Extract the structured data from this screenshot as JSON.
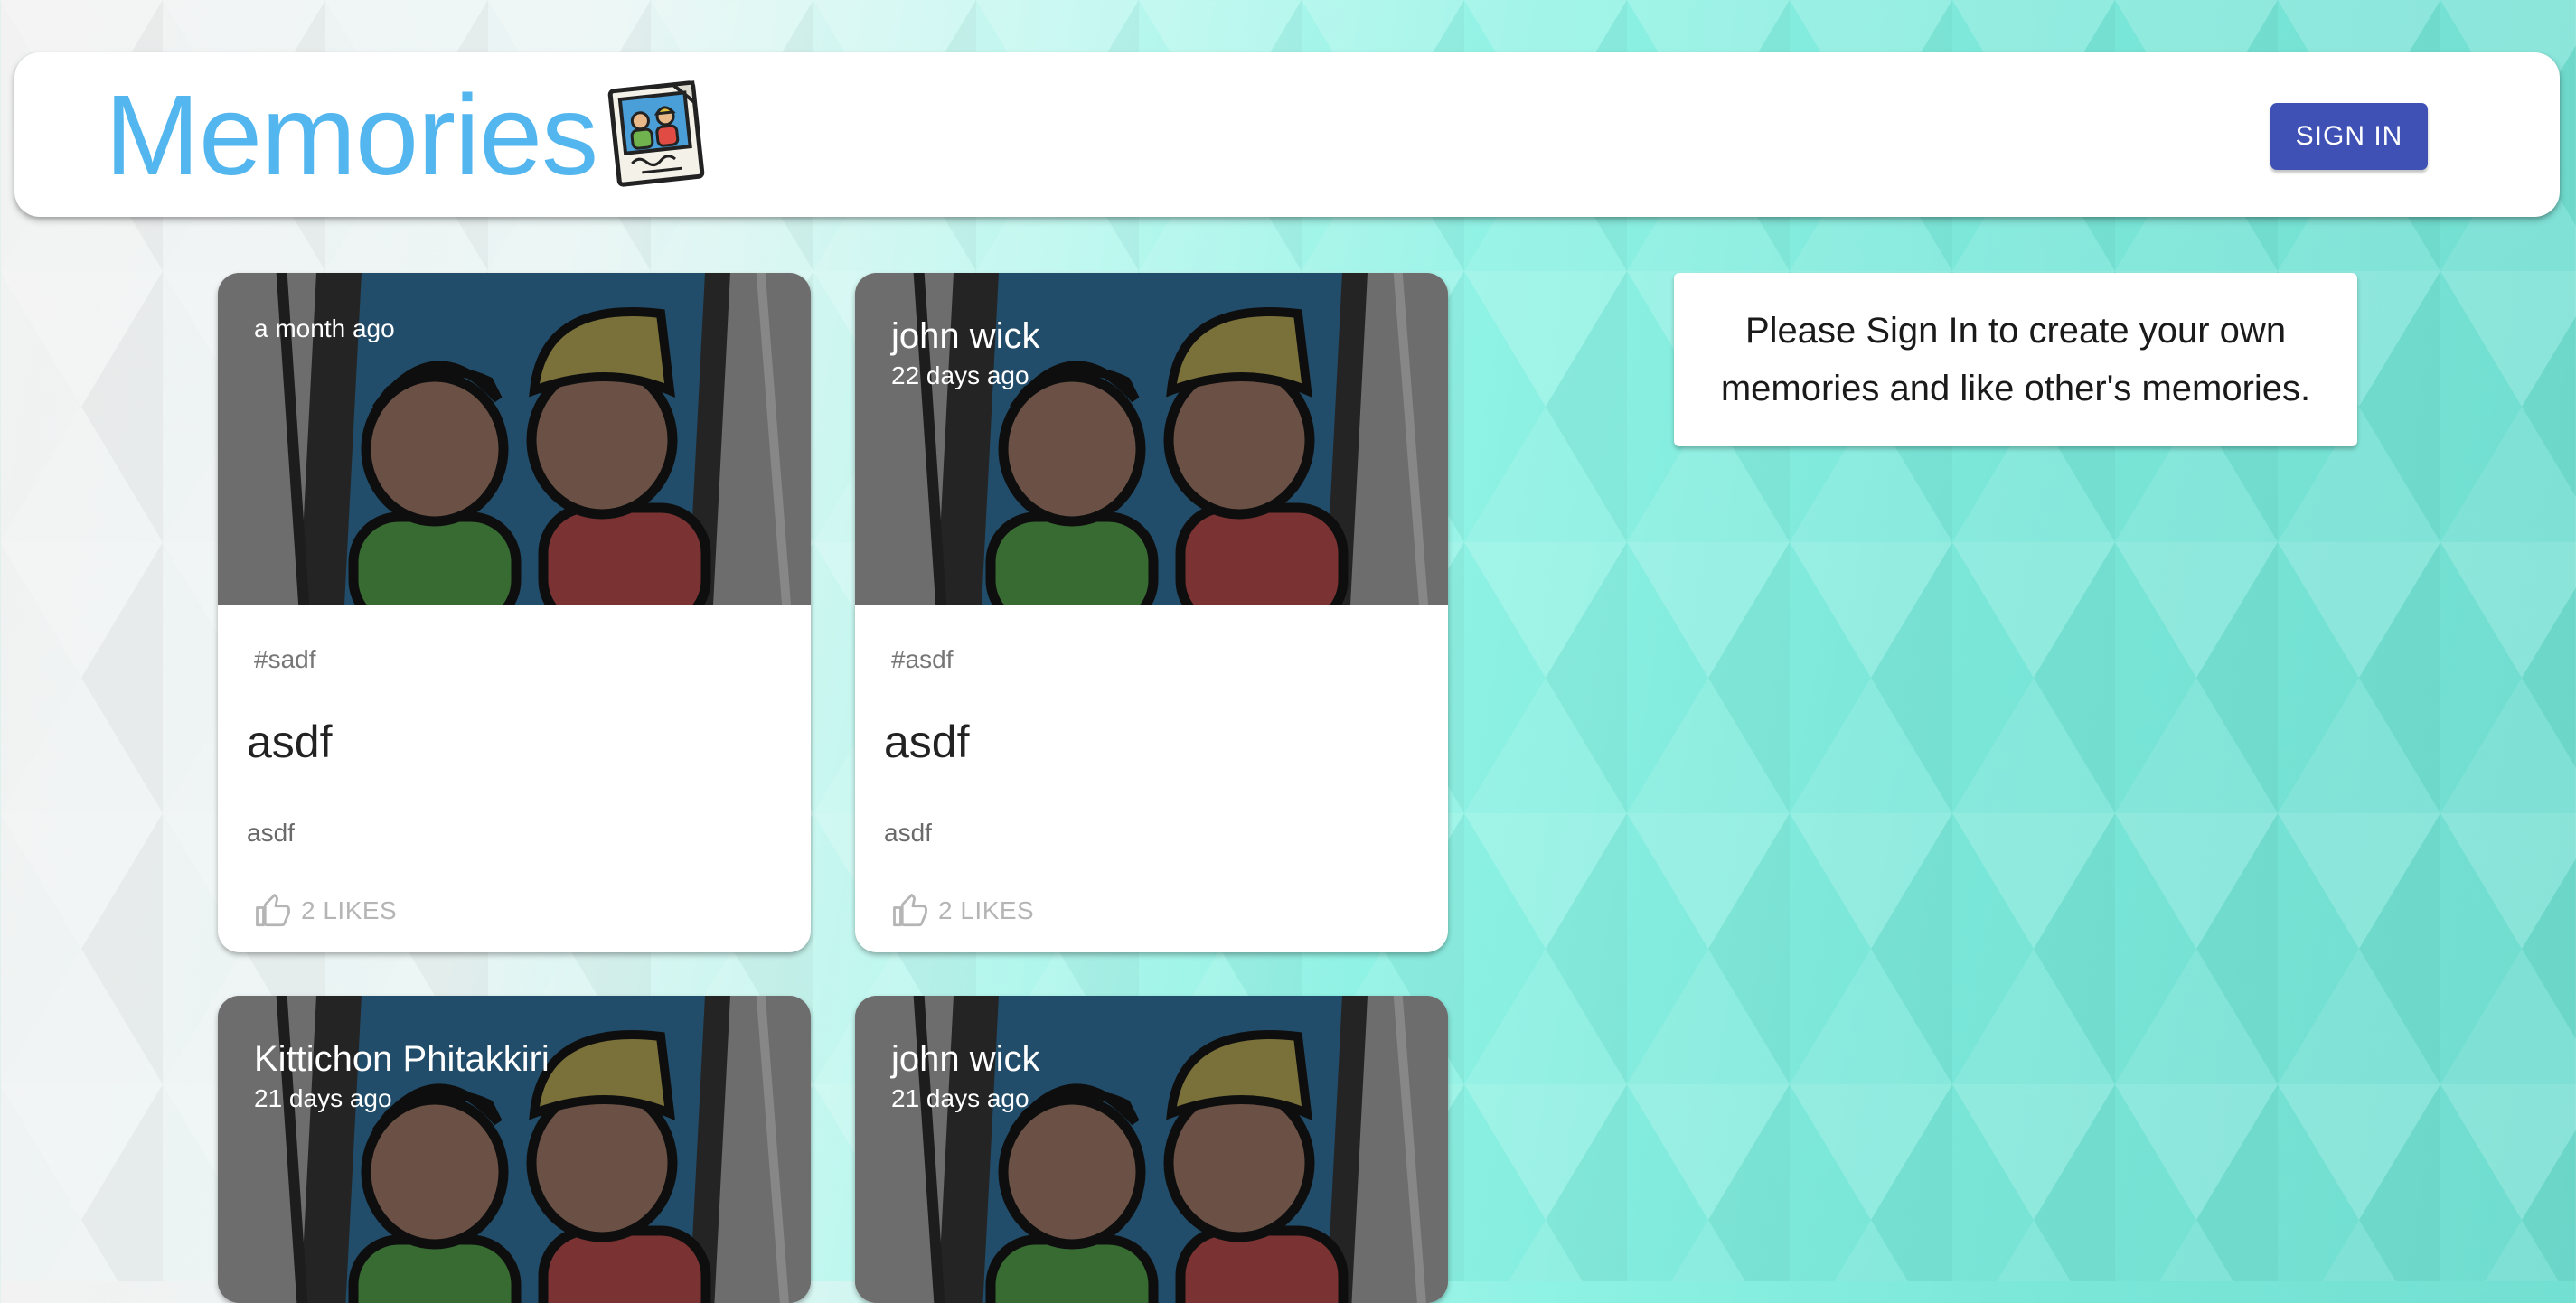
{
  "app": {
    "title": "Memories",
    "sign_in_label": "SIGN IN",
    "logo_icon": "photo-memory-logo",
    "brand_color": "#53b6ee",
    "button_color": "#3f51b5"
  },
  "notice": {
    "text": "Please Sign In to create your own memories and like other's memories."
  },
  "posts": [
    {
      "author": "",
      "time": "a month ago",
      "tags": "#sadf",
      "title": "asdf",
      "message": "asdf",
      "likes": "2 LIKES",
      "like_icon": "thumb-up-outline-icon"
    },
    {
      "author": "john wick",
      "time": "22 days ago",
      "tags": "#asdf",
      "title": "asdf",
      "message": "asdf",
      "likes": "2 LIKES",
      "like_icon": "thumb-up-outline-icon"
    },
    {
      "author": "Kittichon Phitakkiri",
      "time": "21 days ago"
    },
    {
      "author": "john wick",
      "time": "21 days ago"
    }
  ]
}
